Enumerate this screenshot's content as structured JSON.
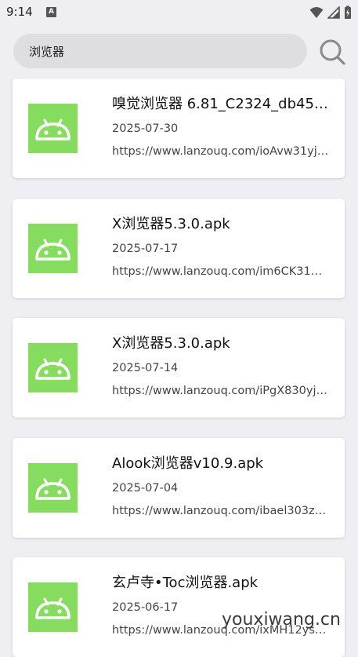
{
  "status_bar": {
    "time": "9:14",
    "notification_icon": "A"
  },
  "search": {
    "query": "浏览器",
    "button_icon": "search-icon"
  },
  "results": [
    {
      "icon": "android-app-icon",
      "title": "嗅觉浏览器 6.81_C2324_db45…",
      "date": "2025-07-30",
      "url": "https://www.lanzouq.com/ioAvw31yj…"
    },
    {
      "icon": "android-app-icon",
      "title": "X浏览器5.3.0.apk",
      "date": "2025-07-17",
      "url": "https://www.lanzouq.com/im6CK31…"
    },
    {
      "icon": "android-app-icon",
      "title": "X浏览器5.3.0.apk",
      "date": "2025-07-14",
      "url": "https://www.lanzouq.com/iPgX830yj…"
    },
    {
      "icon": "android-app-icon",
      "title": "Alook浏览器v10.9.apk",
      "date": "2025-07-04",
      "url": "https://www.lanzouq.com/ibael303z…"
    },
    {
      "icon": "android-app-icon",
      "title": "玄卢寺•Toc浏览器.apk",
      "date": "2025-06-17",
      "url": "https://www.lanzouq.com/ixMH12ys…"
    }
  ],
  "watermark": "youxiwang.cn",
  "colors": {
    "background": "#efeef3",
    "card": "#ffffff",
    "icon_green": "#86dc5f",
    "search_bg": "#dedde2"
  }
}
